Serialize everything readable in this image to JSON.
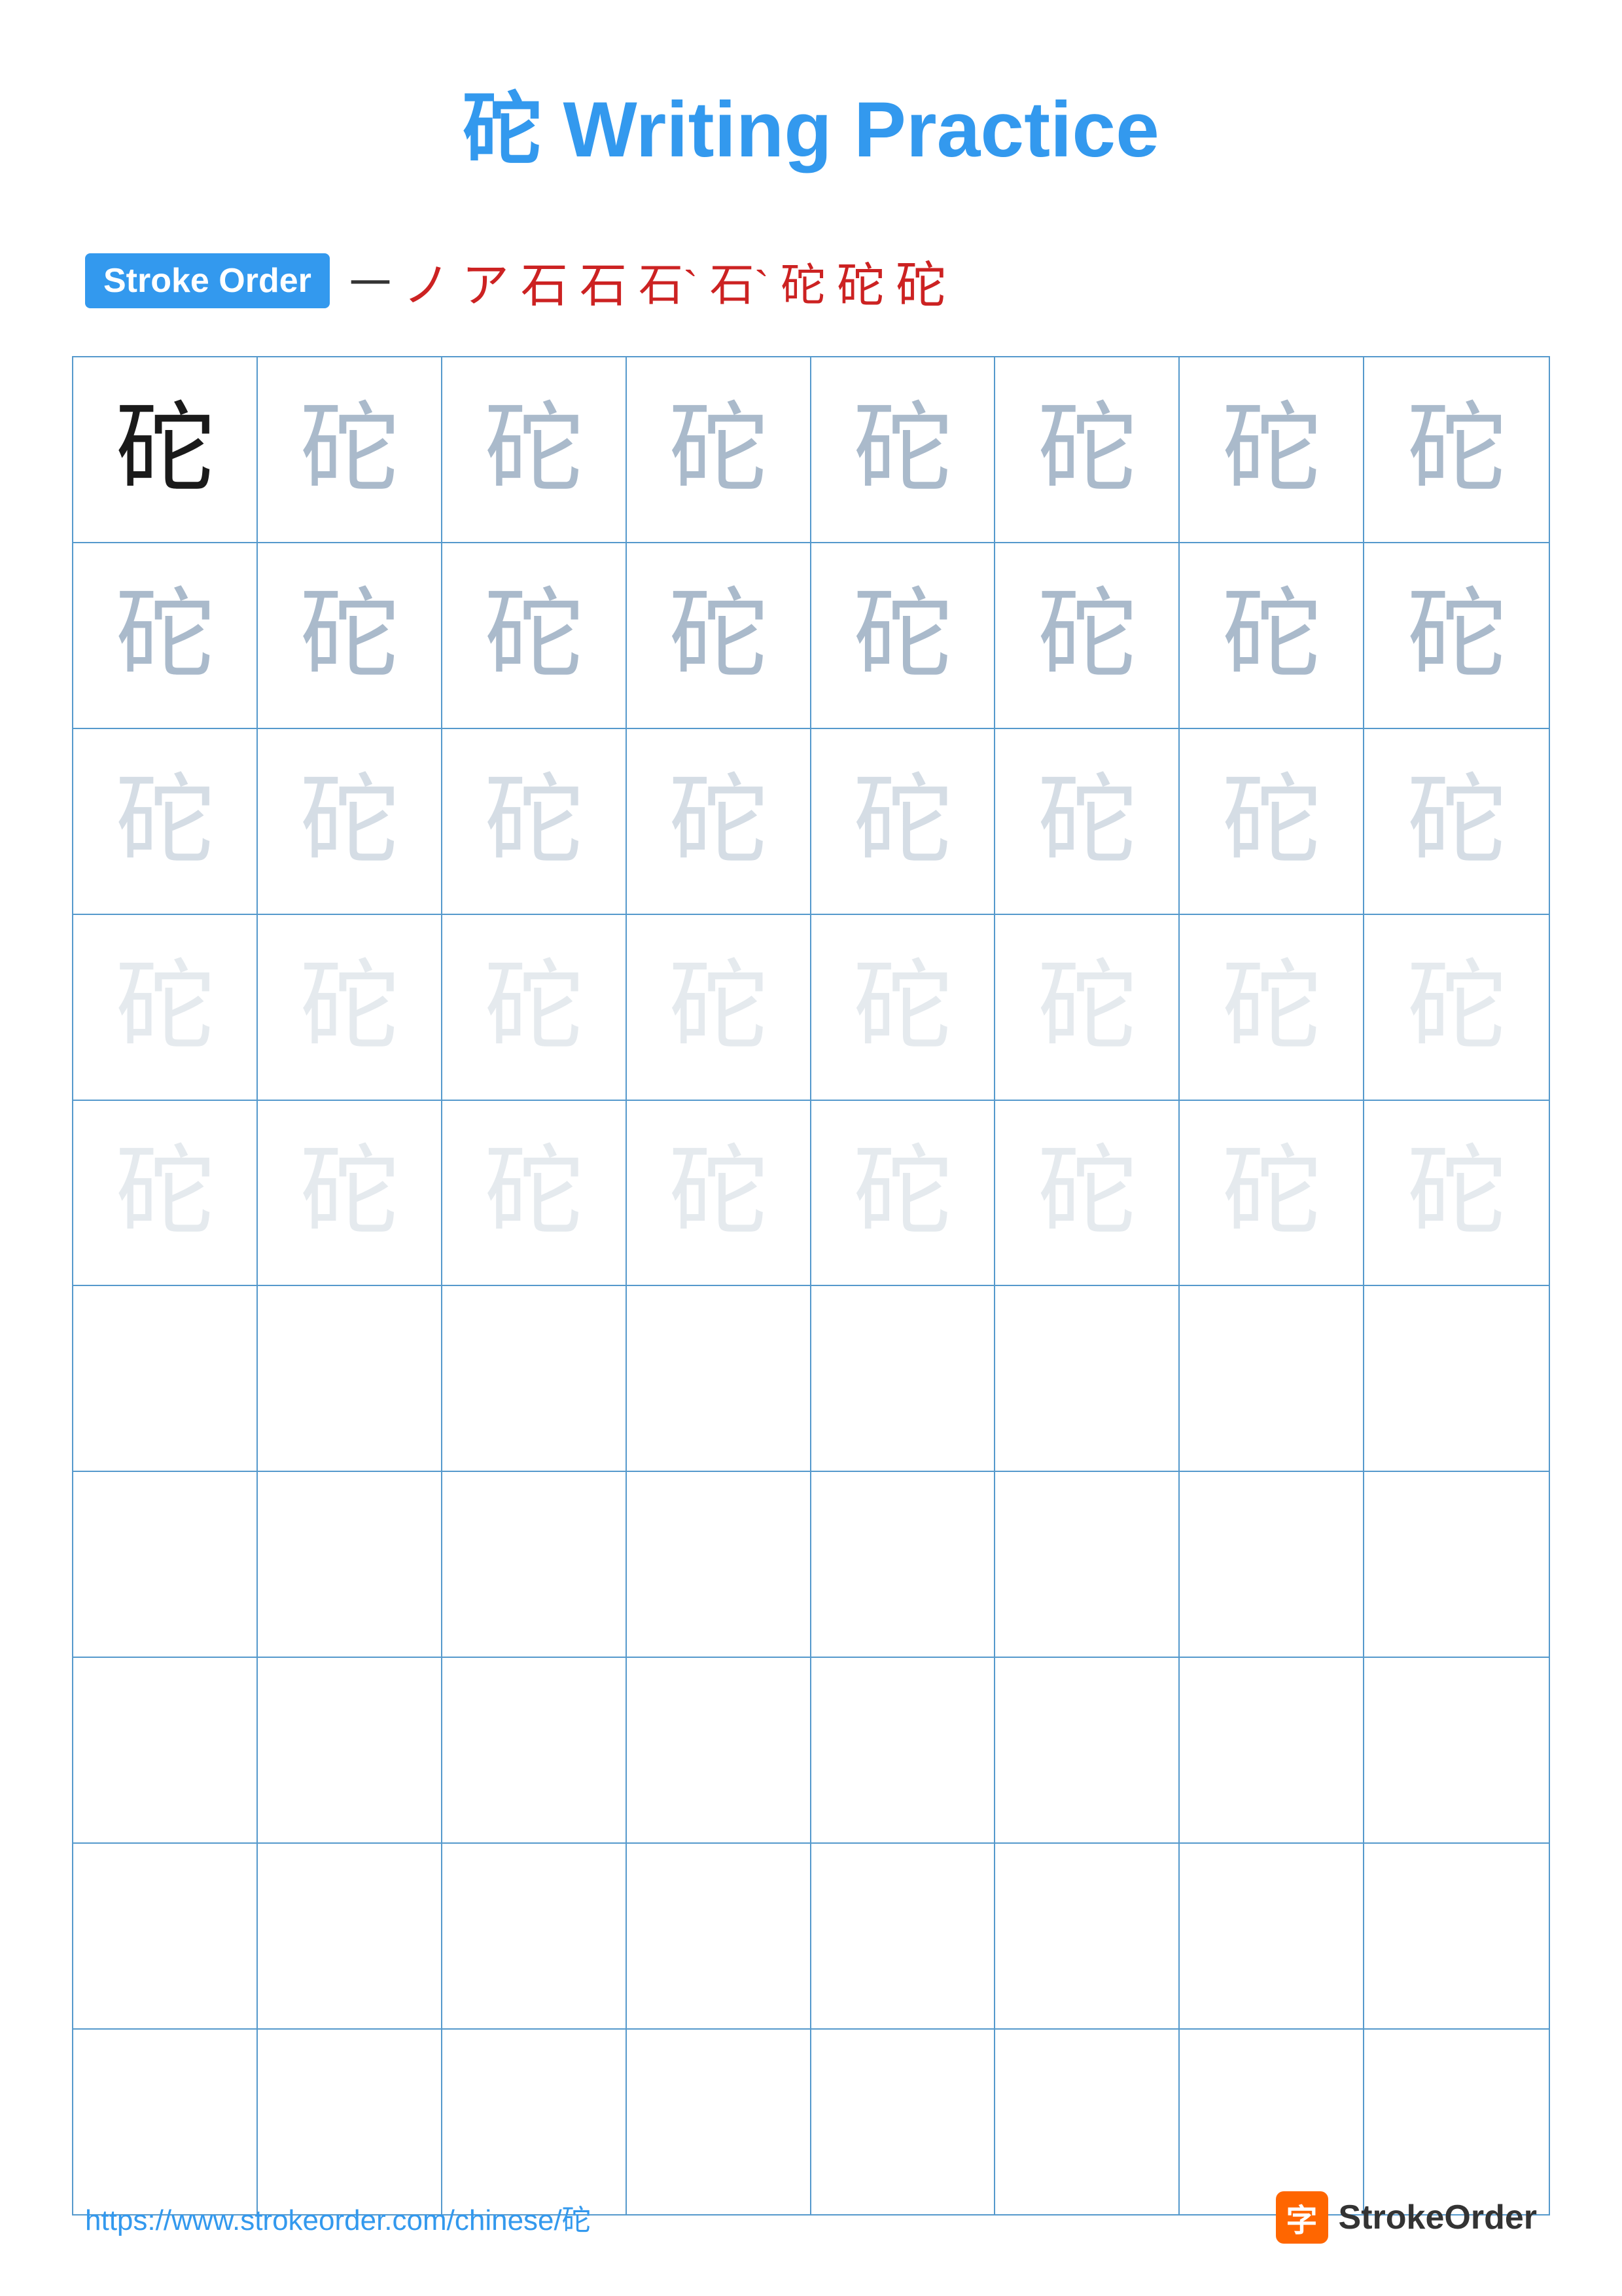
{
  "title": {
    "char": "砣",
    "text": "砣 Writing Practice"
  },
  "stroke_order": {
    "badge_label": "Stroke Order",
    "strokes": [
      "一",
      "ノ",
      "ア",
      "石",
      "石",
      "石`",
      "石`",
      "砣",
      "砣",
      "砣"
    ]
  },
  "grid": {
    "rows": 10,
    "cols": 8,
    "char": "砣",
    "practice_rows": 5,
    "empty_rows": 5
  },
  "footer": {
    "url": "https://www.strokeorder.com/chinese/砣",
    "logo_char": "字",
    "logo_text": "StrokeOrder"
  }
}
